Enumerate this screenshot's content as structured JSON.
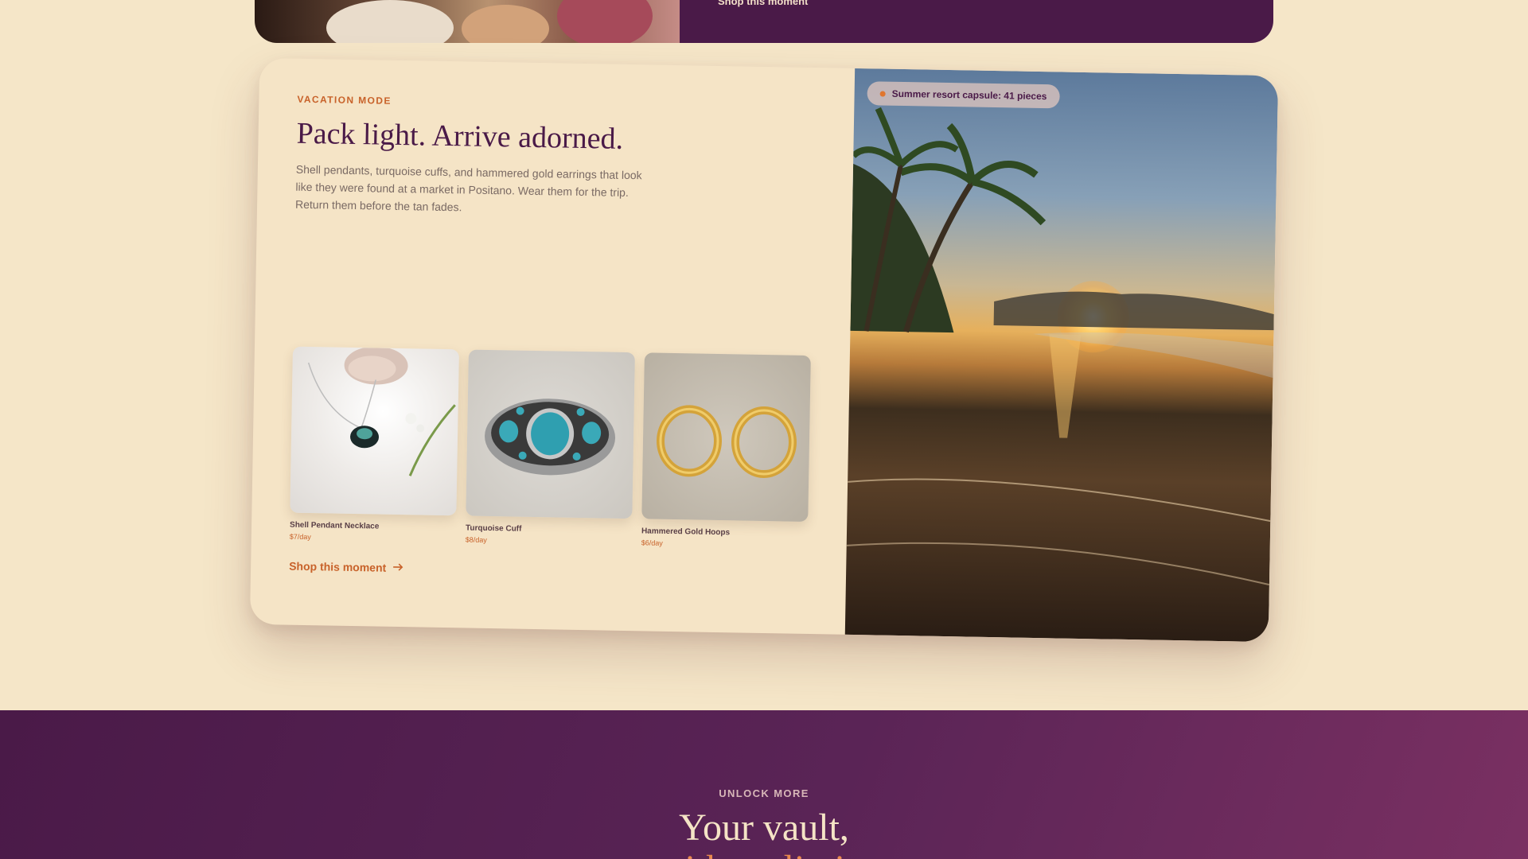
{
  "previous_card": {
    "link_label": "Shop this moment"
  },
  "feature": {
    "eyebrow": "VACATION MODE",
    "headline": "Pack light. Arrive adorned.",
    "body": "Shell pendants, turquoise cuffs, and hammered gold earrings that look like they were found at a market in Positano. Wear them for the trip. Return them before the tan fades.",
    "badge": "Summer resort capsule: 41 pieces",
    "shop_link": "Shop this moment",
    "products": [
      {
        "name": "Shell Pendant Necklace",
        "price": "$7/day"
      },
      {
        "name": "Turquoise Cuff",
        "price": "$8/day"
      },
      {
        "name": "Hammered Gold Hoops",
        "price": "$6/day"
      }
    ]
  },
  "cta_band": {
    "eyebrow": "UNLOCK MORE",
    "title": "Your vault,",
    "title_accent": "without limits"
  },
  "colors": {
    "accent_orange": "#c8622a",
    "plum": "#4a1a48",
    "cream": "#f5e4c6"
  }
}
